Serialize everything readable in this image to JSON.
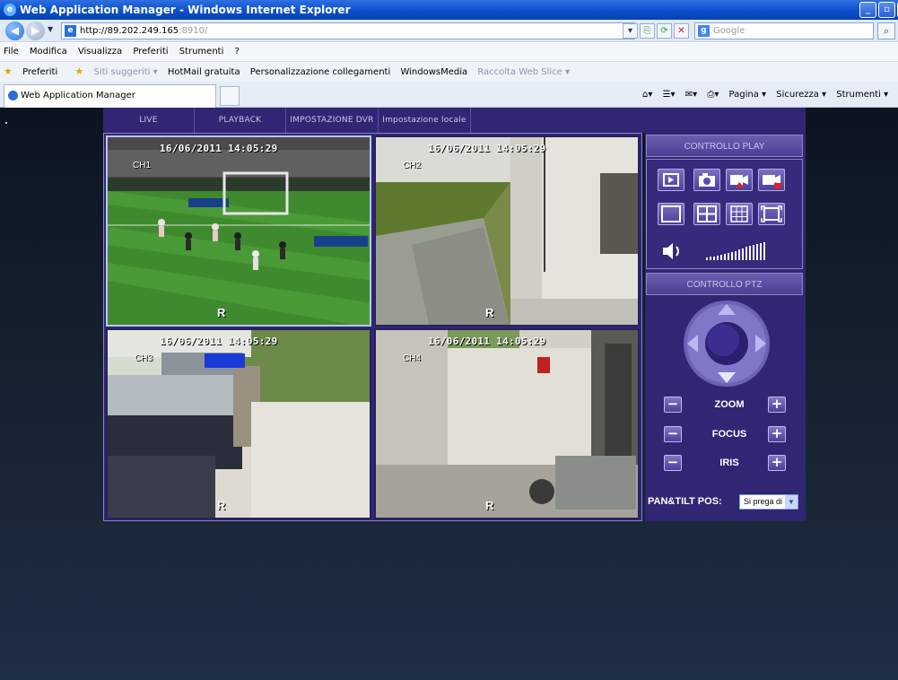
{
  "window": {
    "title": "Web Application Manager - Windows Internet Explorer"
  },
  "address": {
    "url_host": "http://89.202.249.165",
    "url_port": ":8910/"
  },
  "search": {
    "placeholder": "Google"
  },
  "menu": [
    "File",
    "Modifica",
    "Visualizza",
    "Preferiti",
    "Strumenti",
    "?"
  ],
  "favorites": {
    "label": "Preferiti",
    "items": [
      {
        "label": "Siti suggeriti ▾",
        "disabled": true
      },
      {
        "label": "HotMail gratuita",
        "disabled": false
      },
      {
        "label": "Personalizzazione collegamenti",
        "disabled": false
      },
      {
        "label": "WindowsMedia",
        "disabled": false
      },
      {
        "label": "Raccolta Web Slice ▾",
        "disabled": true
      }
    ]
  },
  "tab": {
    "label": "Web Application Manager"
  },
  "commandbar": {
    "page": "Pagina ▾",
    "security": "Sicurezza ▾",
    "tools": "Strumenti ▾"
  },
  "nav": [
    {
      "label": "LIVE"
    },
    {
      "label": "PLAYBACK"
    },
    {
      "label": "IMPOSTAZIONE DVR"
    },
    {
      "label": "Impostazione locale"
    }
  ],
  "cameras": [
    {
      "channel": "CH1",
      "timestamp": "16/06/2011 14:05:29",
      "record": "R"
    },
    {
      "channel": "CH2",
      "timestamp": "16/06/2011 14:05:29",
      "record": "R"
    },
    {
      "channel": "CH3",
      "timestamp": "16/06/2011 14:05:29",
      "record": "R"
    },
    {
      "channel": "CH4",
      "timestamp": "16/06/2011 14:05:29",
      "record": "R"
    }
  ],
  "play_control": {
    "title": "CONTROLLO PLAY"
  },
  "ptz": {
    "title": "CONTROLLO PTZ",
    "zoom": "ZOOM",
    "focus": "FOCUS",
    "iris": "IRIS",
    "pan_tilt_label": "PAN&TILT POS:",
    "pan_tilt_value": "Si prega di"
  },
  "colors": {
    "panel": "#302674",
    "accent": "#6a5fb0",
    "page_bg": "#0c1420"
  }
}
